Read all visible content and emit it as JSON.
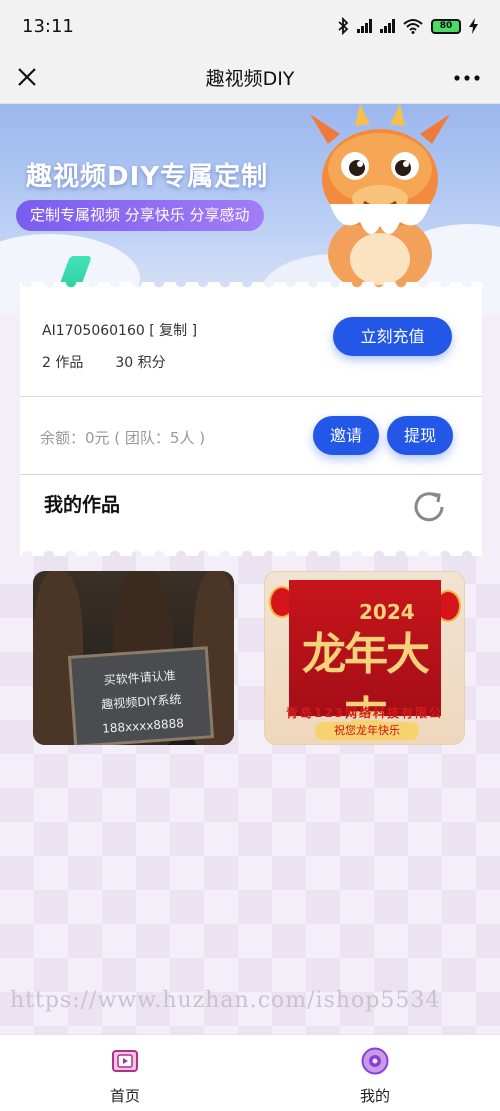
{
  "status_bar": {
    "time": "13:11",
    "battery": "80"
  },
  "title_bar": {
    "title": "趣视频DIY"
  },
  "hero": {
    "title": "趣视频DIY专属定制",
    "tagline": "定制专属视频 分享快乐 分享感动"
  },
  "account": {
    "id_text": "AI1705060160 [ 复制 ]",
    "works_count": "2 作品",
    "points": "30 积分",
    "recharge_label": "立刻充值",
    "balance_text": "余额：0元 ( 团队：5人 )",
    "invite_label": "邀请",
    "withdraw_label": "提现"
  },
  "works": {
    "title": "我的作品",
    "items": [
      {
        "lines": [
          "买软件请认准",
          "趣视频DIY系统",
          "188xxxx8888"
        ]
      },
      {
        "year": "2024",
        "headline": "龙年大吉",
        "company": "青岛123网络科技有限公",
        "wish": "祝您龙年快乐"
      }
    ]
  },
  "watermark": "https://www.huzhan.com/ishop5534",
  "nav": {
    "home_label": "首页",
    "mine_label": "我的"
  },
  "colors": {
    "accent_blue": "#2257e8",
    "pill_purple": "#7a5cf0",
    "nav_purple": "#8a3fd6"
  }
}
